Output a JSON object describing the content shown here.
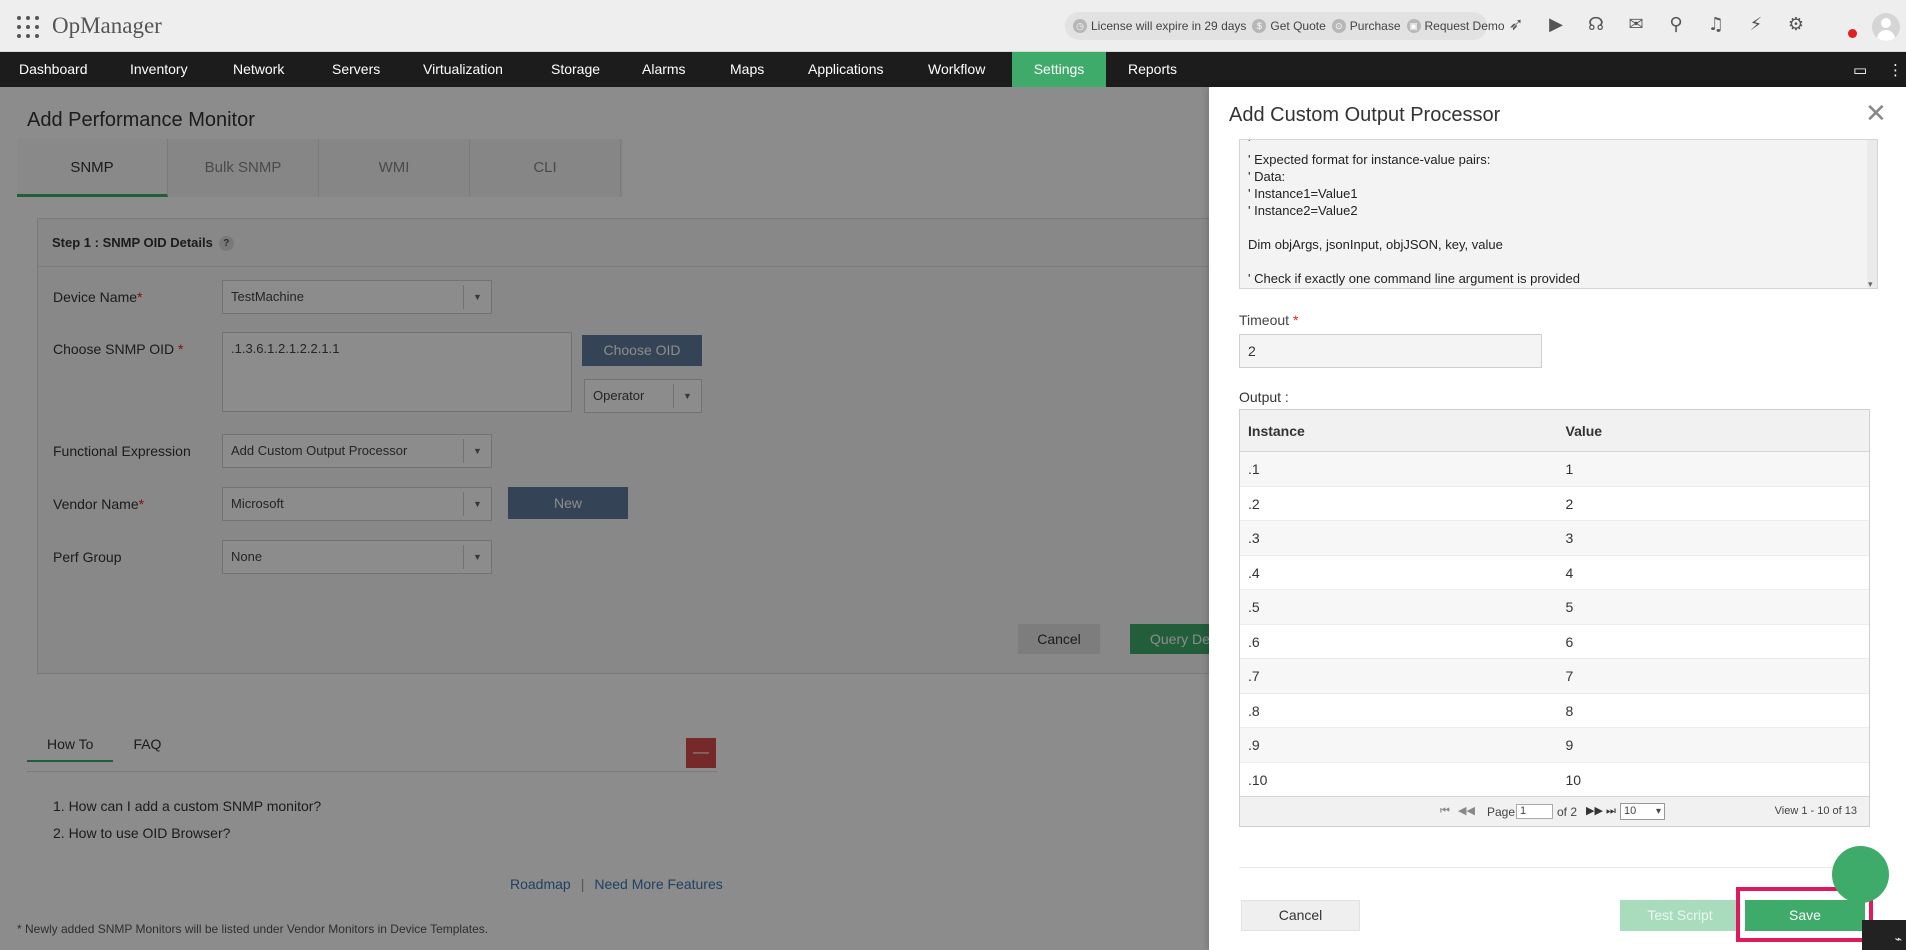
{
  "app": {
    "title": "OpManager"
  },
  "header": {
    "license": "License will expire in 29 days",
    "get_quote": "Get Quote",
    "purchase": "Purchase",
    "request_demo": "Request Demo"
  },
  "nav": {
    "items": [
      "Dashboard",
      "Inventory",
      "Network",
      "Servers",
      "Virtualization",
      "Storage",
      "Alarms",
      "Maps",
      "Applications",
      "Workflow",
      "Settings",
      "Reports"
    ],
    "active": "Settings"
  },
  "page": {
    "title": "Add Performance Monitor",
    "tabs": [
      "SNMP",
      "Bulk SNMP",
      "WMI",
      "CLI"
    ],
    "active_tab": "SNMP",
    "step_title": "Step 1 : SNMP OID Details",
    "help": "?",
    "req_mark": "*",
    "device_name_label": "Device Name",
    "device_name_value": "TestMachine",
    "oid_label": "Choose SNMP OID",
    "oid_value": ".1.3.6.1.2.1.2.2.1.1",
    "choose_oid_button": "Choose OID",
    "operator_value": "Operator",
    "func_expr_label": "Functional Expression",
    "func_expr_value": "Add Custom Output Processor",
    "vendor_label": "Vendor Name",
    "vendor_value": "Microsoft",
    "new_button": "New",
    "perf_group_label": "Perf Group",
    "perf_group_value": "None",
    "cancel_button": "Cancel",
    "query_button": "Query De",
    "howto_tabs": [
      "How To",
      "FAQ"
    ],
    "minus": "—",
    "howto_items": [
      "1. How can I add a custom SNMP monitor?",
      "2. How to use OID Browser?"
    ],
    "roadmap_link": "Roadmap",
    "need_features_link": "Need More Features",
    "link_sep": "|",
    "footnote": "* Newly added SNMP Monitors will be listed under Vendor Monitors in Device Templates."
  },
  "panel": {
    "title": "Add Custom Output Processor",
    "close": "✕",
    "script_lines": [
      "'",
      "' Expected format for instance-value pairs:",
      "' Data:",
      "' Instance1=Value1",
      "' Instance2=Value2",
      "",
      "Dim objArgs, jsonInput, objJSON, key, value",
      "",
      "' Check if exactly one command line argument is provided"
    ],
    "timeout_label": "Timeout",
    "timeout_req": "*",
    "timeout_value": "2",
    "output_label": "Output :",
    "columns": [
      "Instance",
      "Value"
    ],
    "rows": [
      [
        ".1",
        "1"
      ],
      [
        ".2",
        "2"
      ],
      [
        ".3",
        "3"
      ],
      [
        ".4",
        "4"
      ],
      [
        ".5",
        "5"
      ],
      [
        ".6",
        "6"
      ],
      [
        ".7",
        "7"
      ],
      [
        ".8",
        "8"
      ],
      [
        ".9",
        "9"
      ],
      [
        ".10",
        "10"
      ]
    ],
    "pager": {
      "page_label": "Page",
      "page_value": "1",
      "of_label": "of 2",
      "page_size": "10",
      "view": "View 1 - 10 of 13"
    },
    "cancel_button": "Cancel",
    "test_button": "Test Script",
    "save_button": "Save"
  },
  "colors": {
    "accent": "#3fab6a",
    "highlight": "#e0195a",
    "nav_bg": "#1c1c1c"
  }
}
